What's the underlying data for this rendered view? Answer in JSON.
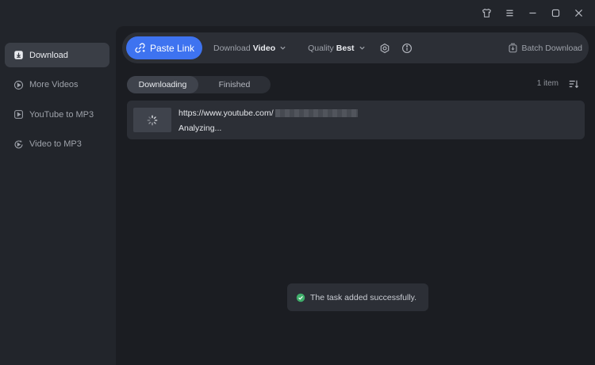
{
  "window": {
    "controls": [
      {
        "name": "skin-icon",
        "label": "skin"
      },
      {
        "name": "menu-icon",
        "label": "menu"
      },
      {
        "name": "minimize-icon",
        "label": "minimize"
      },
      {
        "name": "maximize-icon",
        "label": "maximize"
      },
      {
        "name": "close-icon",
        "label": "close"
      }
    ]
  },
  "sidebar": {
    "items": [
      {
        "label": "Download",
        "icon": "download-icon",
        "active": true
      },
      {
        "label": "More Videos",
        "icon": "play-circle-icon",
        "active": false
      },
      {
        "label": "YouTube to MP3",
        "icon": "play-square-icon",
        "active": false
      },
      {
        "label": "Video to MP3",
        "icon": "video-convert-icon",
        "active": false
      }
    ]
  },
  "toolbar": {
    "paste_label": "Paste Link",
    "download_prefix": "Download",
    "download_value": "Video",
    "quality_prefix": "Quality",
    "quality_value": "Best",
    "batch_label": "Batch Download"
  },
  "tabs": {
    "downloading": "Downloading",
    "finished": "Finished"
  },
  "list": {
    "count": "1 item",
    "items": [
      {
        "url": "https://www.youtube.com/",
        "status": "Analyzing..."
      }
    ]
  },
  "toast": {
    "message": "The task added successfully."
  },
  "colors": {
    "accent": "#3e73f0",
    "success": "#3fae6a",
    "background": "#22252b",
    "panel": "#1b1d22"
  }
}
